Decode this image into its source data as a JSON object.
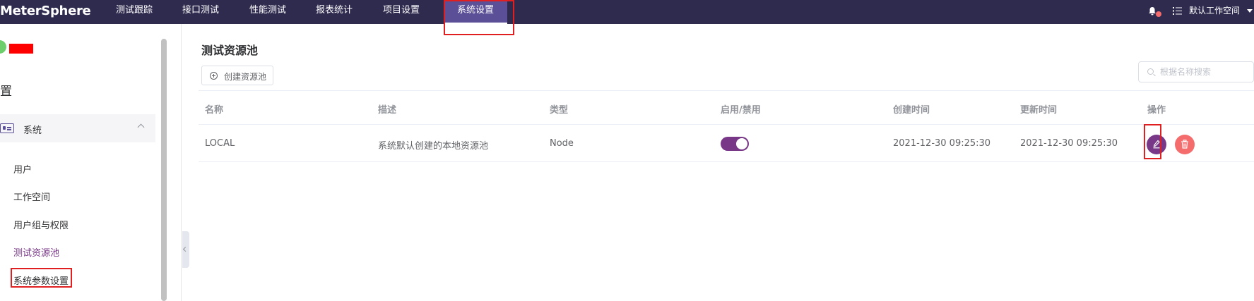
{
  "header": {
    "logo": "MeterSphere",
    "nav": [
      {
        "label": "测试跟踪"
      },
      {
        "label": "接口测试"
      },
      {
        "label": "性能测试"
      },
      {
        "label": "报表统计"
      },
      {
        "label": "项目设置"
      },
      {
        "label": "系统设置",
        "active": true
      }
    ],
    "workspace_label": "默认工作空间"
  },
  "sidebar": {
    "title": "置",
    "group_label": "系统",
    "items": [
      {
        "label": "用户"
      },
      {
        "label": "工作空间"
      },
      {
        "label": "用户组与权限"
      },
      {
        "label": "测试资源池",
        "active": true
      },
      {
        "label": "系统参数设置"
      }
    ]
  },
  "main": {
    "title": "测试资源池",
    "create_button": "创建资源池",
    "search_placeholder": "根据名称搜索",
    "columns": [
      "名称",
      "描述",
      "类型",
      "启用/禁用",
      "创建时间",
      "更新时间",
      "操作"
    ],
    "rows": [
      {
        "name": "LOCAL",
        "description": "系统默认创建的本地资源池",
        "type": "Node",
        "enabled": true,
        "created": "2021-12-30 09:25:30",
        "updated": "2021-12-30 09:25:30"
      }
    ]
  },
  "colors": {
    "header_bg": "#2f2b4f",
    "nav_active_bg": "#5b4f97",
    "accent": "#783887",
    "danger": "#f56c6c",
    "highlight_box": "#e02020"
  },
  "icons": {
    "notification": "bell-icon",
    "workspace": "list-icon",
    "create": "plus-circle-icon",
    "search": "search-icon",
    "edit": "edit-icon",
    "delete": "delete-icon"
  }
}
